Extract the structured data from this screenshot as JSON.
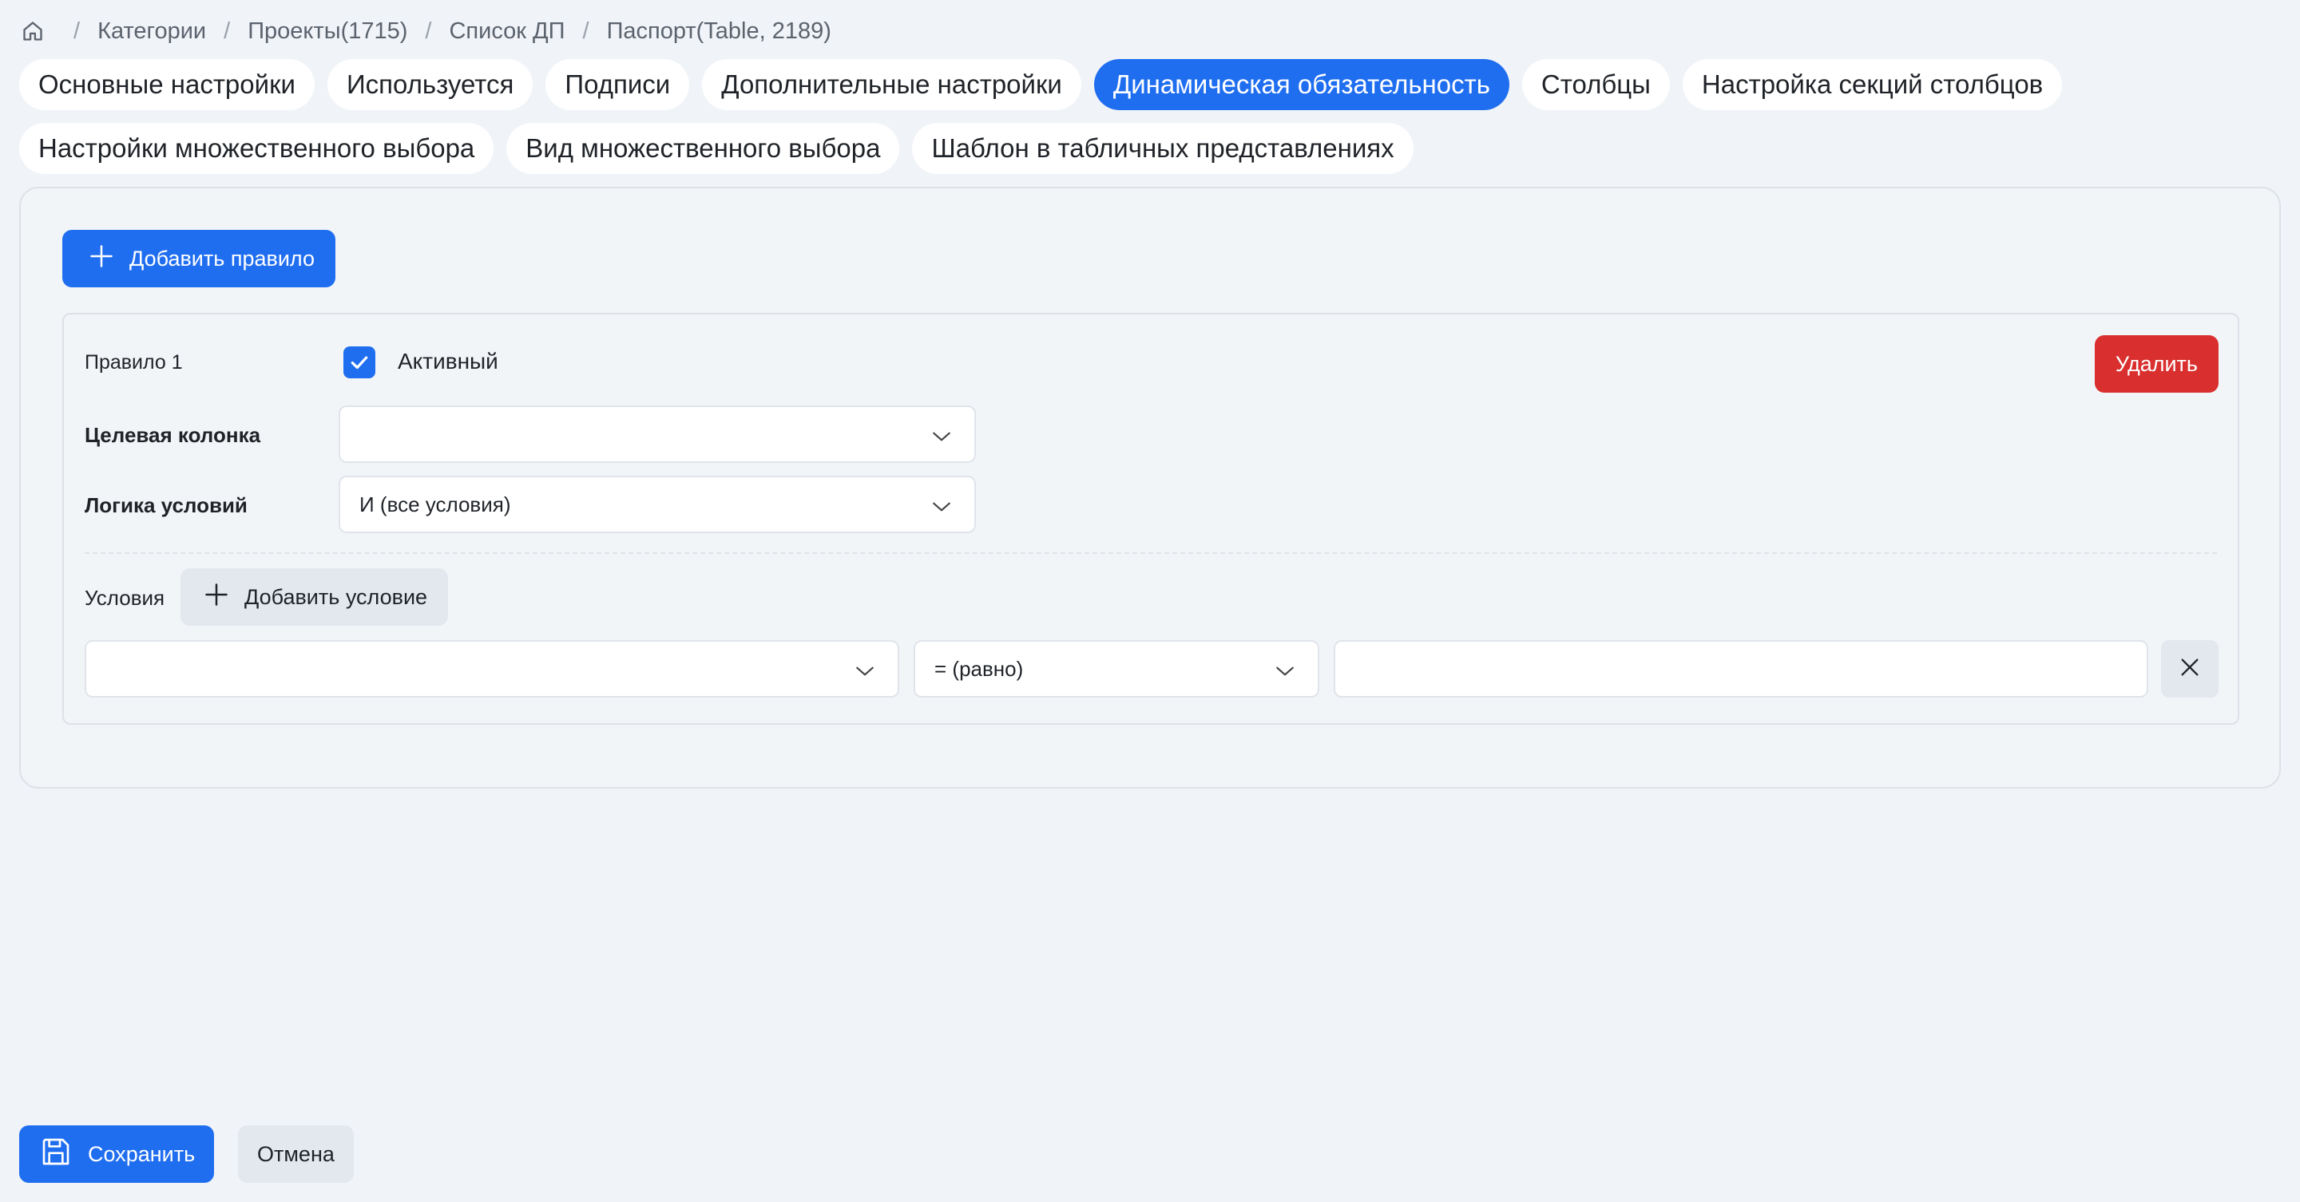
{
  "breadcrumb": {
    "home_icon": "home-icon",
    "items": [
      "Категории",
      "Проекты(1715)",
      "Список ДП",
      "Паспорт(Table, 2189)"
    ],
    "separator": "/"
  },
  "tabs": [
    {
      "label": "Основные настройки",
      "active": false
    },
    {
      "label": "Используется",
      "active": false
    },
    {
      "label": "Подписи",
      "active": false
    },
    {
      "label": "Дополнительные настройки",
      "active": false
    },
    {
      "label": "Динамическая обязательность",
      "active": true
    },
    {
      "label": "Столбцы",
      "active": false
    },
    {
      "label": "Настройка секций столбцов",
      "active": false
    },
    {
      "label": "Настройки множественного выбора",
      "active": false
    },
    {
      "label": "Вид множественного выбора",
      "active": false
    },
    {
      "label": "Шаблон в табличных представлениях",
      "active": false
    }
  ],
  "panel": {
    "add_rule_label": "Добавить правило",
    "rule": {
      "title": "Правило 1",
      "active_checked": true,
      "active_label": "Активный",
      "delete_label": "Удалить",
      "target_column_label": "Целевая колонка",
      "target_column_value": "",
      "logic_label": "Логика условий",
      "logic_value": "И (все условия)",
      "conditions_label": "Условия",
      "add_condition_label": "Добавить условие",
      "condition": {
        "field_value": "",
        "operator_value": "= (равно)",
        "compare_value": ""
      }
    }
  },
  "footer": {
    "save_label": "Сохранить",
    "cancel_label": "Отмена"
  },
  "colors": {
    "accent": "#1f6ef0",
    "danger": "#d9302f",
    "background": "#f0f3f7"
  }
}
